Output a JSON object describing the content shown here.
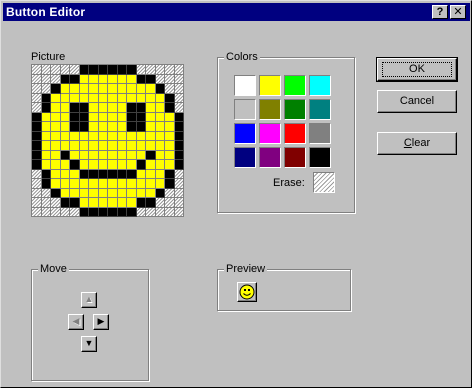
{
  "window": {
    "title": "Button Editor",
    "help_glyph": "?",
    "close_glyph": "✕"
  },
  "picture": {
    "label": "Picture",
    "size": 16,
    "legend": {
      "e": "empty",
      "k": "black",
      "y": "yellow"
    },
    "pixels": [
      "eeeeekkkkkkeeeee",
      "eeekkyyyyyykkeee",
      "eekyyyyyyyyyykee",
      "ekyyyyyyyyyyyyke",
      "ekyykkyyyykkyyke",
      "kyyykkyyyykkyyyk",
      "kyyykkyyyykkyyyk",
      "kyyyyyyyyyyyyyyk",
      "kyyyyyyyyyyyyyyk",
      "kyykyyyyyyyykyyk",
      "kyyykyyyyyykyyyk",
      "ekyyykkkkkkyyyke",
      "ekyyyyyyyyyyyyke",
      "eekyyyyyyyyyykee",
      "eeekkyyyyyykkeee",
      "eeeeekkkkkkeeeee"
    ],
    "colors": {
      "black": "#000000",
      "yellow": "#ffff00"
    }
  },
  "colors_group": {
    "label": "Colors",
    "swatches": [
      "#ffffff",
      "#ffff00",
      "#00ff00",
      "#00ffff",
      "#c0c0c0",
      "#808000",
      "#008000",
      "#008080",
      "#0000ff",
      "#ff00ff",
      "#ff0000",
      "#808080",
      "#000080",
      "#800080",
      "#800000",
      "#000000"
    ],
    "selected_index": 15,
    "erase_label": "Erase:"
  },
  "buttons": {
    "ok": "OK",
    "cancel": "Cancel",
    "clear_prefix": "C",
    "clear_rest": "lear"
  },
  "move_group": {
    "label": "Move",
    "up_icon": "▲",
    "left_icon": "◀",
    "right_icon": "▶",
    "down_icon": "▼"
  },
  "preview_group": {
    "label": "Preview"
  }
}
